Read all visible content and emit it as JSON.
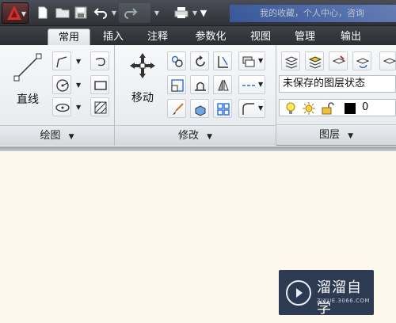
{
  "title_bar": {
    "bluetitle_text": "我的收藏，个人中心，咨询"
  },
  "tabs": [
    "常用",
    "插入",
    "注释",
    "参数化",
    "视图",
    "管理",
    "输出"
  ],
  "ribbon": {
    "draw_panel": {
      "big_label": "直线",
      "footer": "绘图"
    },
    "modify_panel": {
      "big_label": "移动",
      "footer": "修改"
    },
    "layers_panel": {
      "layer_state": "未保存的图层状态",
      "current_layer": "0",
      "footer": "图层"
    }
  },
  "watermark": {
    "title": "溜溜自学",
    "url": "ZIXUE.3066.COM"
  },
  "colors": {
    "accent": "#3b63b5",
    "app_red": "#c03030",
    "titlebar": "#3a3d44"
  }
}
